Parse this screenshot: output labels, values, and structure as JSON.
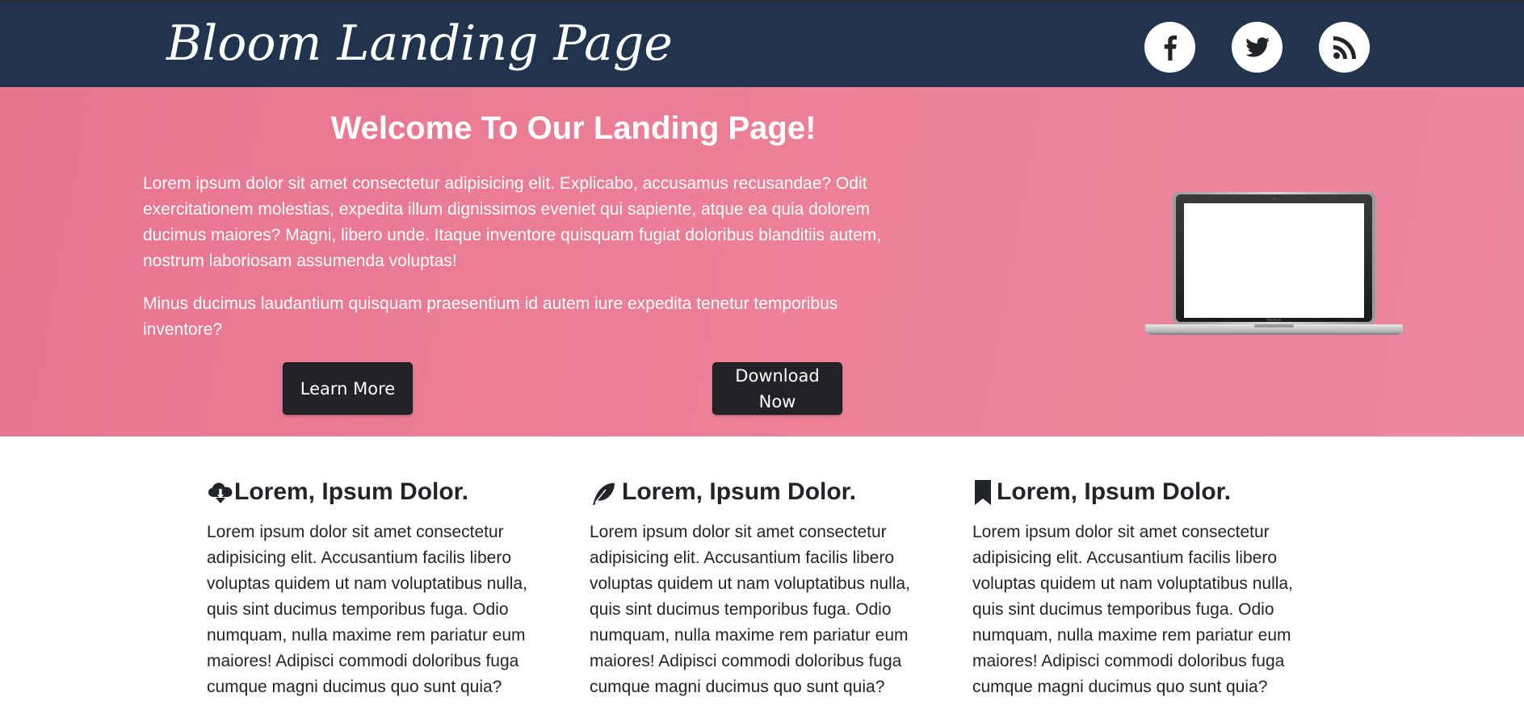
{
  "header": {
    "brand": "Bloom Landing Page",
    "social": [
      {
        "name": "facebook-icon"
      },
      {
        "name": "twitter-icon"
      },
      {
        "name": "rss-icon"
      }
    ]
  },
  "hero": {
    "title": "Welcome To Our Landing Page!",
    "paragraph1": "Lorem ipsum dolor sit amet consectetur adipisicing elit. Explicabo, accusamus recusandae? Odit exercitationem molestias, expedita illum dignissimos eveniet qui sapiente, atque ea quia dolorem ducimus maiores? Magni, libero unde. Itaque inventore quisquam fugiat doloribus blanditiis autem, nostrum laboriosam assumenda voluptas!",
    "paragraph2": "Minus ducimus laudantium quisquam praesentium id autem iure expedita tenetur temporibus inventore?",
    "learn_more_label": "Learn More",
    "download_label": "Download Now",
    "image": "laptop-image"
  },
  "features": [
    {
      "icon": "cloud-download-icon",
      "title": "Lorem, Ipsum Dolor.",
      "text": "Lorem ipsum dolor sit amet consectetur adipisicing elit. Accusantium facilis libero voluptas quidem ut nam voluptatibus nulla, quis sint ducimus temporibus fuga. Odio numquam, nulla maxime rem pariatur eum maiores! Adipisci commodi doloribus fuga cumque magni ducimus quo sunt quia?"
    },
    {
      "icon": "feather-icon",
      "title": "Lorem, Ipsum Dolor.",
      "text": "Lorem ipsum dolor sit amet consectetur adipisicing elit. Accusantium facilis libero voluptas quidem ut nam voluptatibus nulla, quis sint ducimus temporibus fuga. Odio numquam, nulla maxime rem pariatur eum maiores! Adipisci commodi doloribus fuga cumque magni ducimus quo sunt quia?"
    },
    {
      "icon": "bookmark-icon",
      "title": "Lorem, Ipsum Dolor.",
      "text": "Lorem ipsum dolor sit amet consectetur adipisicing elit. Accusantium facilis libero voluptas quidem ut nam voluptatibus nulla, quis sint ducimus temporibus fuga. Odio numquam, nulla maxime rem pariatur eum maiores! Adipisci commodi doloribus fuga cumque magni ducimus quo sunt quia?"
    }
  ],
  "colors": {
    "header_bg": "#22344d",
    "hero_bg": "#ea7e96",
    "button_bg": "#212327",
    "text_dark": "#212529"
  }
}
